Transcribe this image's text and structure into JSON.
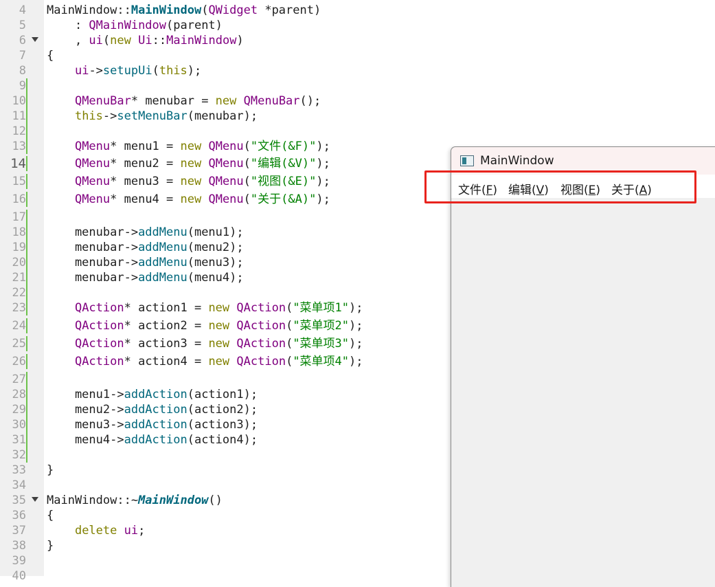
{
  "code_lines": [
    {
      "n": "4",
      "tokens": [
        [
          "MainWindow::",
          "plain"
        ],
        [
          "MainWindow",
          "bold"
        ],
        [
          "(",
          "plain"
        ],
        [
          "QWidget",
          "type"
        ],
        [
          " *parent)",
          "plain"
        ]
      ]
    },
    {
      "n": "5",
      "tokens": [
        [
          "    : ",
          "plain"
        ],
        [
          "QMainWindow",
          "type"
        ],
        [
          "(parent)",
          "plain"
        ]
      ]
    },
    {
      "n": "6",
      "fold": true,
      "tokens": [
        [
          "    , ",
          "plain"
        ],
        [
          "ui",
          "type"
        ],
        [
          "(",
          "plain"
        ],
        [
          "new",
          "kw"
        ],
        [
          " ",
          "plain"
        ],
        [
          "Ui",
          "type"
        ],
        [
          "::",
          "plain"
        ],
        [
          "MainWindow",
          "type"
        ],
        [
          ")",
          "plain"
        ]
      ]
    },
    {
      "n": "7",
      "tokens": [
        [
          "{",
          "plain"
        ]
      ]
    },
    {
      "n": "8",
      "tokens": [
        [
          "    ",
          "plain"
        ],
        [
          "ui",
          "type"
        ],
        [
          "->",
          "plain"
        ],
        [
          "setupUi",
          "func"
        ],
        [
          "(",
          "plain"
        ],
        [
          "this",
          "kw"
        ],
        [
          ");",
          "plain"
        ]
      ]
    },
    {
      "n": "9",
      "changed": true,
      "tokens": []
    },
    {
      "n": "10",
      "changed": true,
      "tokens": [
        [
          "    ",
          "plain"
        ],
        [
          "QMenuBar",
          "type"
        ],
        [
          "* menubar = ",
          "plain"
        ],
        [
          "new",
          "kw"
        ],
        [
          " ",
          "plain"
        ],
        [
          "QMenuBar",
          "type"
        ],
        [
          "();",
          "plain"
        ]
      ]
    },
    {
      "n": "11",
      "changed": true,
      "tokens": [
        [
          "    ",
          "plain"
        ],
        [
          "this",
          "kw"
        ],
        [
          "->",
          "plain"
        ],
        [
          "setMenuBar",
          "func"
        ],
        [
          "(menubar);",
          "plain"
        ]
      ]
    },
    {
      "n": "12",
      "changed": true,
      "tokens": []
    },
    {
      "n": "13",
      "changed": true,
      "tokens": [
        [
          "    ",
          "plain"
        ],
        [
          "QMenu",
          "type"
        ],
        [
          "* menu1 = ",
          "plain"
        ],
        [
          "new",
          "kw"
        ],
        [
          " ",
          "plain"
        ],
        [
          "QMenu",
          "type"
        ],
        [
          "(",
          "plain"
        ],
        [
          "\"文件(&F)\"",
          "str"
        ],
        [
          ");",
          "plain"
        ]
      ]
    },
    {
      "n": "14",
      "changed": true,
      "big": true,
      "tokens": [
        [
          "    ",
          "plain"
        ],
        [
          "QMenu",
          "type"
        ],
        [
          "* menu2 = ",
          "plain"
        ],
        [
          "new",
          "kw"
        ],
        [
          " ",
          "plain"
        ],
        [
          "QMenu",
          "type"
        ],
        [
          "(",
          "plain"
        ],
        [
          "\"编辑(&V)\"",
          "str"
        ],
        [
          ");",
          "plain"
        ]
      ]
    },
    {
      "n": "15",
      "changed": true,
      "tokens": [
        [
          "    ",
          "plain"
        ],
        [
          "QMenu",
          "type"
        ],
        [
          "* menu3 = ",
          "plain"
        ],
        [
          "new",
          "kw"
        ],
        [
          " ",
          "plain"
        ],
        [
          "QMenu",
          "type"
        ],
        [
          "(",
          "plain"
        ],
        [
          "\"视图(&E)\"",
          "str"
        ],
        [
          ");",
          "plain"
        ]
      ]
    },
    {
      "n": "16",
      "changed": true,
      "tokens": [
        [
          "    ",
          "plain"
        ],
        [
          "QMenu",
          "type"
        ],
        [
          "* menu4 = ",
          "plain"
        ],
        [
          "new",
          "kw"
        ],
        [
          " ",
          "plain"
        ],
        [
          "QMenu",
          "type"
        ],
        [
          "(",
          "plain"
        ],
        [
          "\"关于(&A)\"",
          "str"
        ],
        [
          ");",
          "plain"
        ]
      ]
    },
    {
      "n": "17",
      "changed": true,
      "tokens": []
    },
    {
      "n": "18",
      "changed": true,
      "tokens": [
        [
          "    menubar->",
          "plain"
        ],
        [
          "addMenu",
          "func"
        ],
        [
          "(menu1);",
          "plain"
        ]
      ]
    },
    {
      "n": "19",
      "changed": true,
      "tokens": [
        [
          "    menubar->",
          "plain"
        ],
        [
          "addMenu",
          "func"
        ],
        [
          "(menu2);",
          "plain"
        ]
      ]
    },
    {
      "n": "20",
      "changed": true,
      "tokens": [
        [
          "    menubar->",
          "plain"
        ],
        [
          "addMenu",
          "func"
        ],
        [
          "(menu3);",
          "plain"
        ]
      ]
    },
    {
      "n": "21",
      "changed": true,
      "tokens": [
        [
          "    menubar->",
          "plain"
        ],
        [
          "addMenu",
          "func"
        ],
        [
          "(menu4);",
          "plain"
        ]
      ]
    },
    {
      "n": "22",
      "changed": true,
      "tokens": []
    },
    {
      "n": "23",
      "changed": true,
      "tokens": [
        [
          "    ",
          "plain"
        ],
        [
          "QAction",
          "type"
        ],
        [
          "* action1 = ",
          "plain"
        ],
        [
          "new",
          "kw"
        ],
        [
          " ",
          "plain"
        ],
        [
          "QAction",
          "type"
        ],
        [
          "(",
          "plain"
        ],
        [
          "\"菜单项1\"",
          "str"
        ],
        [
          ");",
          "plain"
        ]
      ]
    },
    {
      "n": "24",
      "changed": true,
      "tokens": [
        [
          "    ",
          "plain"
        ],
        [
          "QAction",
          "type"
        ],
        [
          "* action2 = ",
          "plain"
        ],
        [
          "new",
          "kw"
        ],
        [
          " ",
          "plain"
        ],
        [
          "QAction",
          "type"
        ],
        [
          "(",
          "plain"
        ],
        [
          "\"菜单项2\"",
          "str"
        ],
        [
          ");",
          "plain"
        ]
      ]
    },
    {
      "n": "25",
      "changed": true,
      "tokens": [
        [
          "    ",
          "plain"
        ],
        [
          "QAction",
          "type"
        ],
        [
          "* action3 = ",
          "plain"
        ],
        [
          "new",
          "kw"
        ],
        [
          " ",
          "plain"
        ],
        [
          "QAction",
          "type"
        ],
        [
          "(",
          "plain"
        ],
        [
          "\"菜单项3\"",
          "str"
        ],
        [
          ");",
          "plain"
        ]
      ]
    },
    {
      "n": "26",
      "changed": true,
      "tokens": [
        [
          "    ",
          "plain"
        ],
        [
          "QAction",
          "type"
        ],
        [
          "* action4 = ",
          "plain"
        ],
        [
          "new",
          "kw"
        ],
        [
          " ",
          "plain"
        ],
        [
          "QAction",
          "type"
        ],
        [
          "(",
          "plain"
        ],
        [
          "\"菜单项4\"",
          "str"
        ],
        [
          ");",
          "plain"
        ]
      ]
    },
    {
      "n": "27",
      "changed": true,
      "tokens": []
    },
    {
      "n": "28",
      "changed": true,
      "tokens": [
        [
          "    menu1->",
          "plain"
        ],
        [
          "addAction",
          "func"
        ],
        [
          "(action1);",
          "plain"
        ]
      ]
    },
    {
      "n": "29",
      "changed": true,
      "tokens": [
        [
          "    menu2->",
          "plain"
        ],
        [
          "addAction",
          "func"
        ],
        [
          "(action2);",
          "plain"
        ]
      ]
    },
    {
      "n": "30",
      "changed": true,
      "tokens": [
        [
          "    menu3->",
          "plain"
        ],
        [
          "addAction",
          "func"
        ],
        [
          "(action3);",
          "plain"
        ]
      ]
    },
    {
      "n": "31",
      "changed": true,
      "tokens": [
        [
          "    menu4->",
          "plain"
        ],
        [
          "addAction",
          "func"
        ],
        [
          "(action4);",
          "plain"
        ]
      ]
    },
    {
      "n": "32",
      "changed": true,
      "tokens": []
    },
    {
      "n": "33",
      "tokens": [
        [
          "}",
          "plain"
        ]
      ]
    },
    {
      "n": "34",
      "tokens": []
    },
    {
      "n": "35",
      "fold": true,
      "tokens": [
        [
          "MainWindow::~",
          "plain"
        ],
        [
          "MainWindow",
          "boldi"
        ],
        [
          "()",
          "plain"
        ]
      ]
    },
    {
      "n": "36",
      "tokens": [
        [
          "{",
          "plain"
        ]
      ]
    },
    {
      "n": "37",
      "tokens": [
        [
          "    ",
          "plain"
        ],
        [
          "delete",
          "kw"
        ],
        [
          " ",
          "plain"
        ],
        [
          "ui",
          "type"
        ],
        [
          ";",
          "plain"
        ]
      ]
    },
    {
      "n": "38",
      "tokens": [
        [
          "}",
          "plain"
        ]
      ]
    },
    {
      "n": "39",
      "tokens": []
    },
    {
      "n": "40",
      "tokens": []
    }
  ],
  "window": {
    "title": "MainWindow",
    "icon": "qt-window-icon",
    "menus": [
      {
        "name": "menu-file",
        "label": "文件(",
        "acc": "F",
        "close": ")"
      },
      {
        "name": "menu-edit",
        "label": "编辑(",
        "acc": "V",
        "close": ")"
      },
      {
        "name": "menu-view",
        "label": "视图(",
        "acc": "E",
        "close": ")"
      },
      {
        "name": "menu-about",
        "label": "关于(",
        "acc": "A",
        "close": ")"
      }
    ]
  },
  "colors": {
    "highlight_box": "#e8231d",
    "type": "#800080",
    "keyword": "#808000",
    "function": "#00677c",
    "string": "#008000",
    "changed_marker": "#6cc24a"
  }
}
